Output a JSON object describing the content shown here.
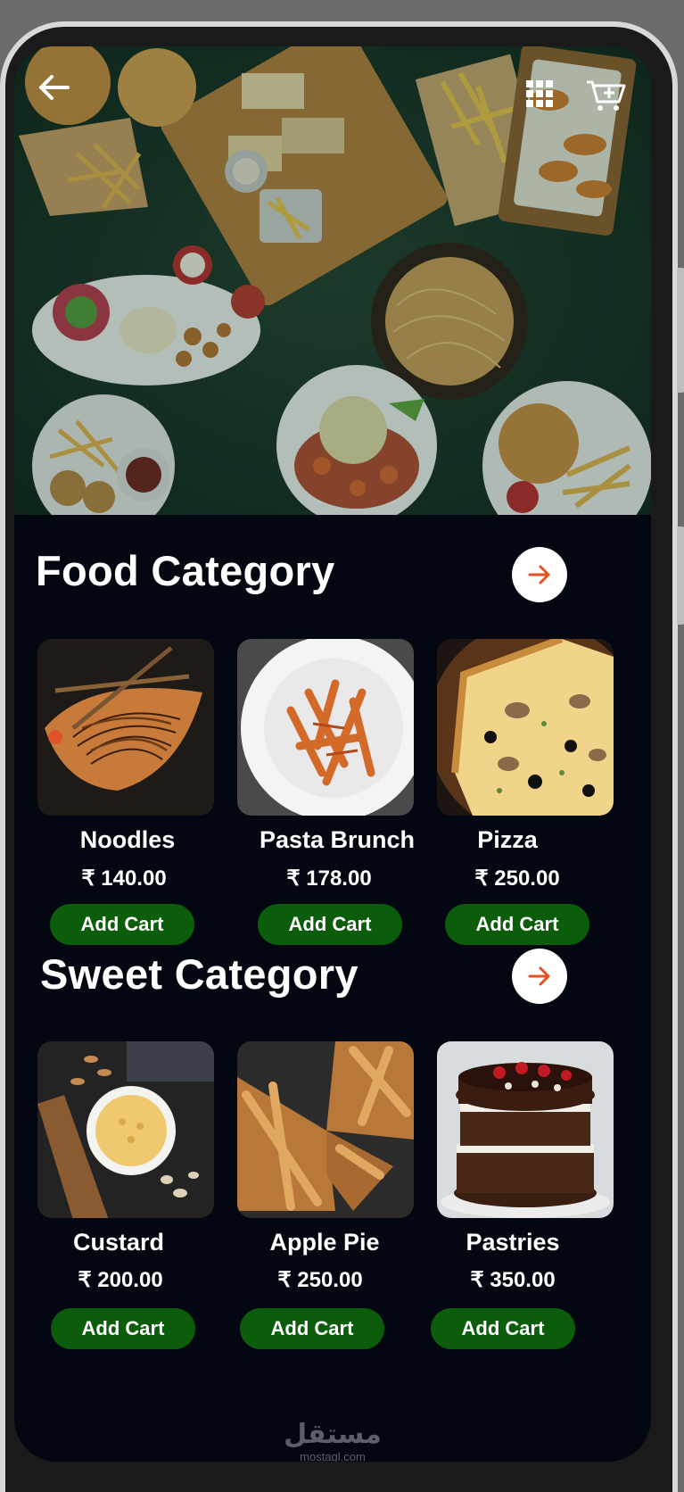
{
  "colors": {
    "background": "#030712",
    "accent_orange": "#e8501e",
    "button_green": "#0b5c0b",
    "text": "#ffffff"
  },
  "header": {
    "back_icon": "arrow-left-icon",
    "grid_icon": "grid-icon",
    "cart_icon": "cart-add-icon"
  },
  "food": {
    "title": "Food Category",
    "arrow_icon": "arrow-right-icon",
    "items": [
      {
        "name": "Noodles",
        "price": "₹ 140.00",
        "button": "Add Cart"
      },
      {
        "name": "Pasta Brunch",
        "price": "₹ 178.00",
        "button": "Add Cart"
      },
      {
        "name": "Pizza",
        "price": "₹ 250.00",
        "button": "Add Cart"
      }
    ]
  },
  "sweet": {
    "title": "Sweet Category",
    "arrow_icon": "arrow-right-icon",
    "items": [
      {
        "name": "Custard",
        "price": "₹ 200.00",
        "button": "Add Cart"
      },
      {
        "name": "Apple Pie",
        "price": "₹ 250.00",
        "button": "Add Cart"
      },
      {
        "name": "Pastries",
        "price": "₹ 350.00",
        "button": "Add Cart"
      }
    ]
  },
  "watermark": {
    "arabic": "مستقل",
    "latin": "mostaql.com"
  }
}
